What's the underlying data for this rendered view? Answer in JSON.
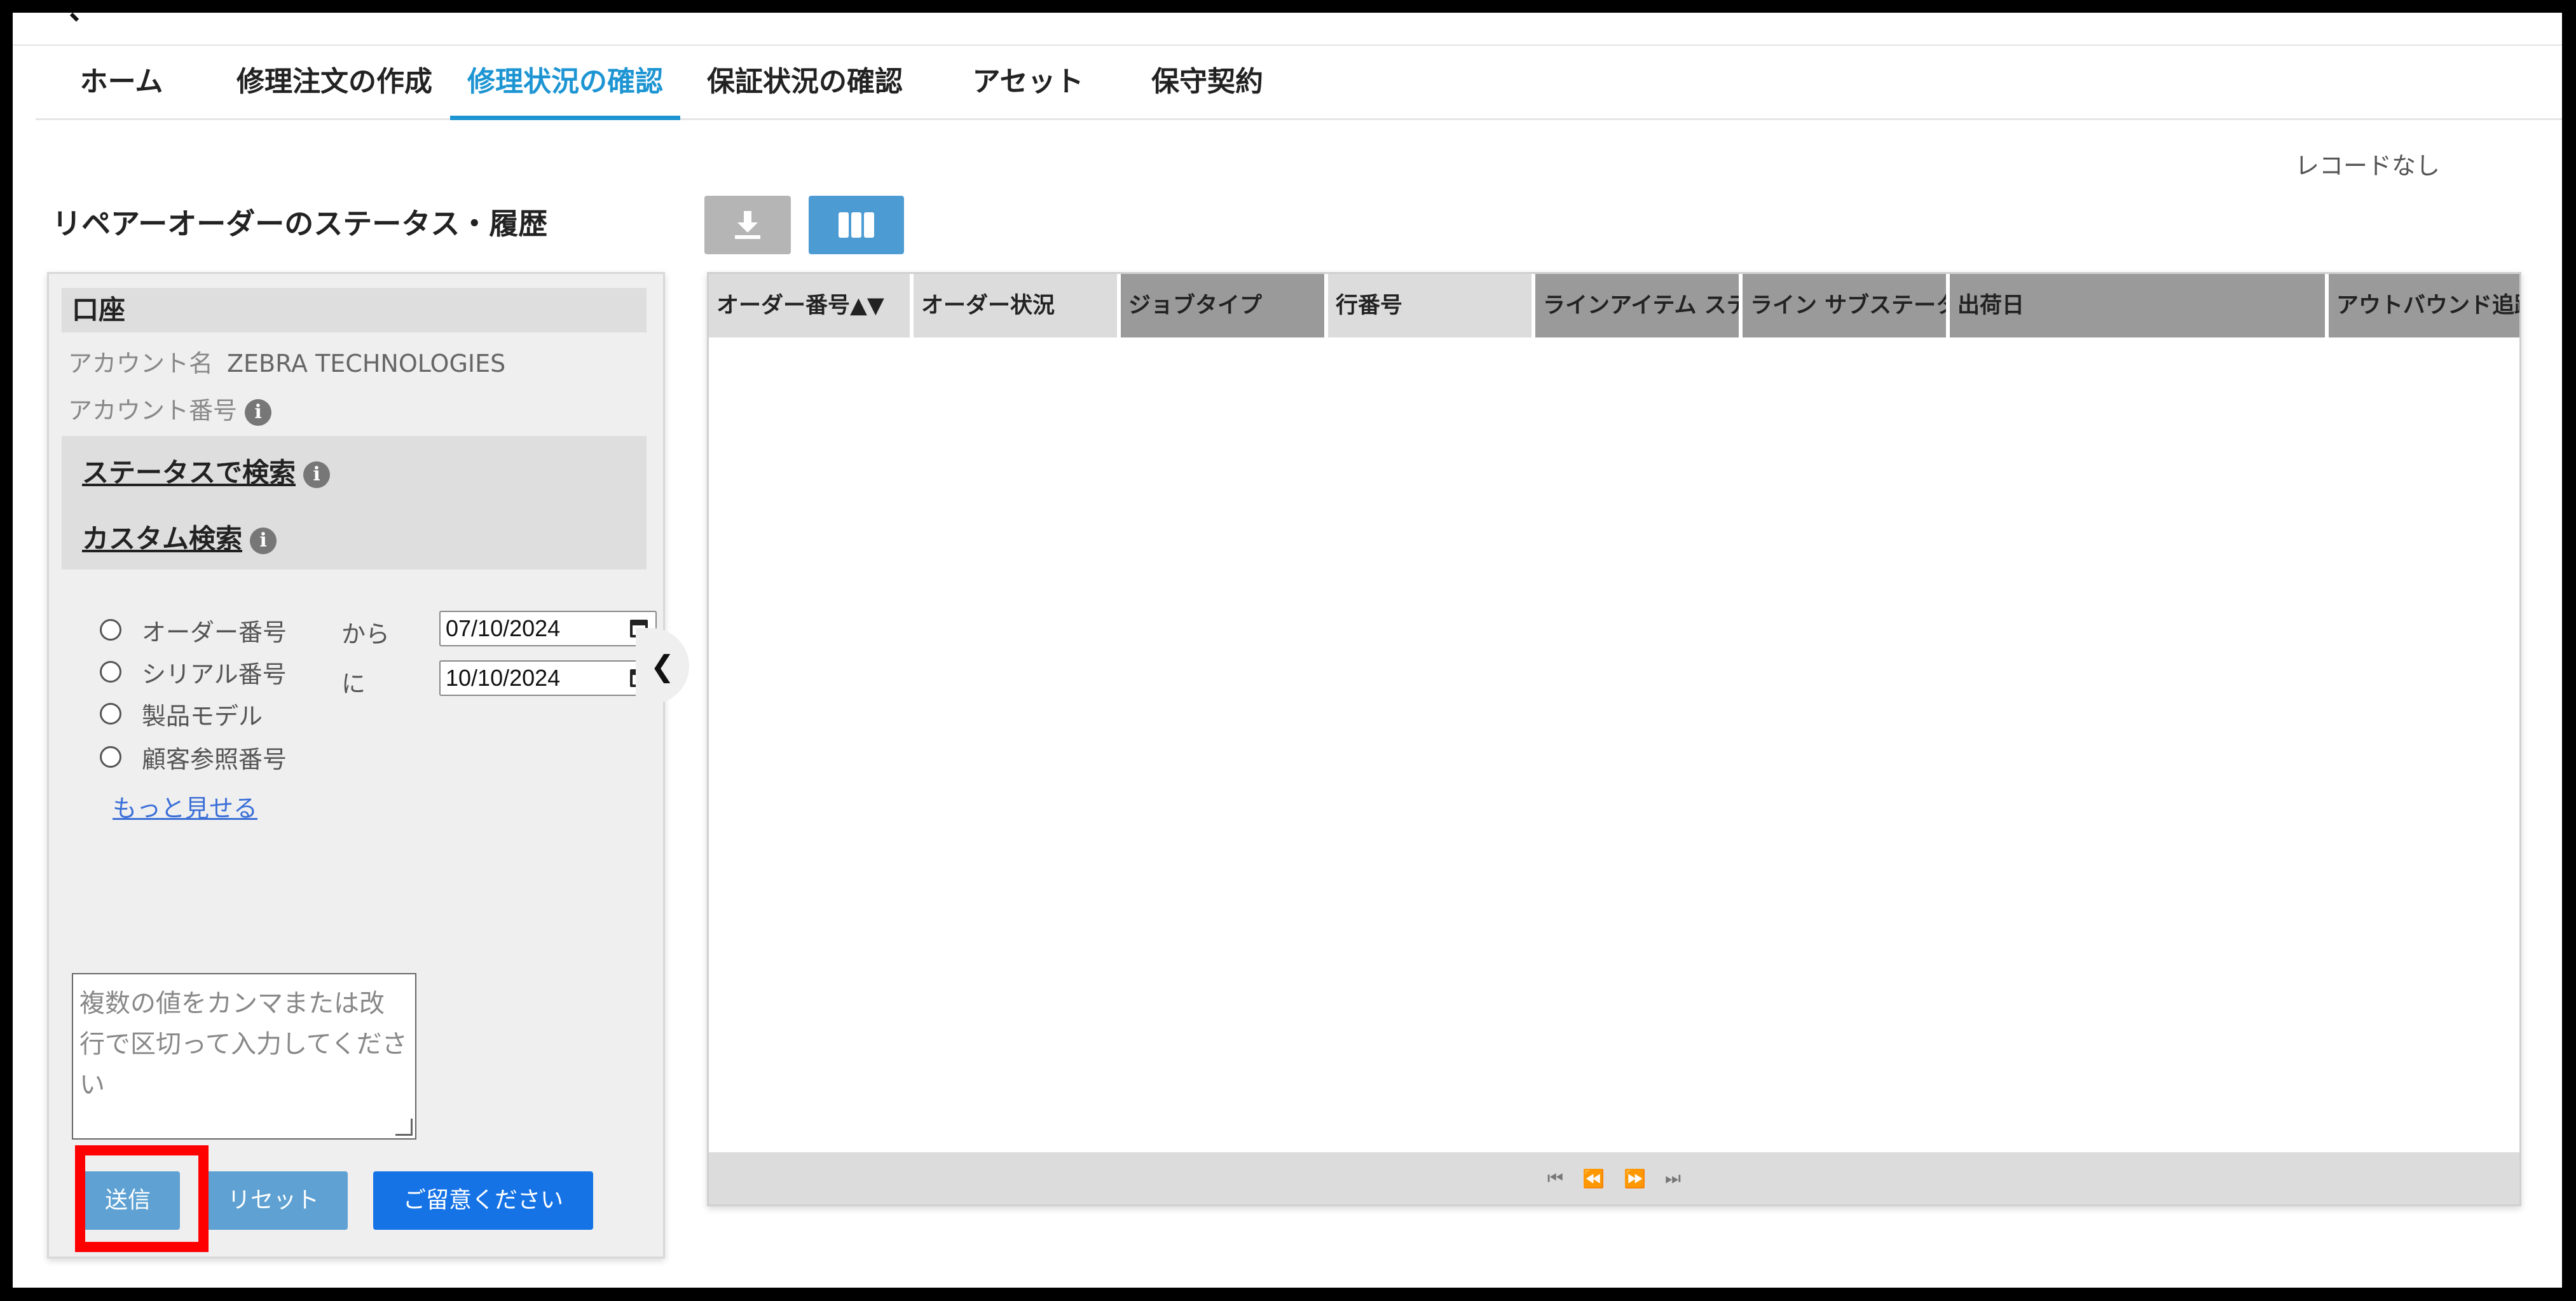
{
  "nav": {
    "tabs": [
      {
        "label": "ホーム"
      },
      {
        "label": "修理注文の作成"
      },
      {
        "label": "修理状況の確認"
      },
      {
        "label": "保証状況の確認"
      },
      {
        "label": "アセット"
      },
      {
        "label": "保守契約"
      }
    ],
    "active_index": 2
  },
  "status_text": "レコードなし",
  "page_title": "リペアーオーダーのステータス・履歴",
  "toolbar": {
    "download_icon": "download-icon",
    "columns_icon": "columns-icon"
  },
  "sidebar": {
    "account_heading": "口座",
    "account_name_label": "アカウント名",
    "account_name_value": "ZEBRA TECHNOLOGIES",
    "account_number_label": "アカウント番号",
    "search_by_status": "ステータスで検索",
    "custom_search": "カスタム検索",
    "search_options": [
      {
        "label": "オーダー番号"
      },
      {
        "label": "シリアル番号"
      },
      {
        "label": "製品モデル"
      },
      {
        "label": "顧客参照番号"
      }
    ],
    "from_label": "から",
    "to_label": "に",
    "from_date": "07/10/2024",
    "to_date": "10/10/2024",
    "show_more": "もっと見せる",
    "textarea_placeholder": "複数の値をカンマまたは改行で区切って入力してください",
    "submit_label": "送信",
    "reset_label": "リセット",
    "notice_label": "ご留意ください"
  },
  "grid": {
    "columns": [
      {
        "label": "オーダー番号▲▼"
      },
      {
        "label": "オーダー状況"
      },
      {
        "label": "ジョブタイプ"
      },
      {
        "label": "行番号"
      },
      {
        "label": "ラインアイテム ステータス"
      },
      {
        "label": "ライン サブステータス"
      },
      {
        "label": "出荷日"
      },
      {
        "label": "アウトバウンド追跡"
      }
    ],
    "pager": {
      "first": "⏮",
      "prev": "⏪",
      "next": "⏩",
      "last": "⏭"
    }
  },
  "colors": {
    "accent": "#1e95d3",
    "button": "#5ea1d2",
    "primary_button": "#1673e6",
    "highlight": "#ff0000"
  }
}
